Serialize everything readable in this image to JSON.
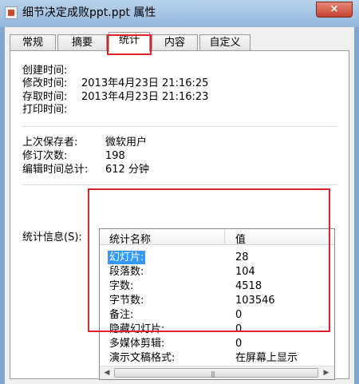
{
  "window": {
    "title": "细节决定成败ppt.ppt 属性",
    "close_icon": "×"
  },
  "tabs": [
    {
      "label": "常规"
    },
    {
      "label": "摘要"
    },
    {
      "label": "统计"
    },
    {
      "label": "内容"
    },
    {
      "label": "自定义"
    }
  ],
  "dates": {
    "created_label": "创建时间:",
    "created_value": "",
    "modified_label": "修改时间:",
    "modified_value": "2013年4月23日 21:16:25",
    "accessed_label": "存取时间:",
    "accessed_value": "2013年4月23日 21:16:23",
    "printed_label": "打印时间:",
    "printed_value": ""
  },
  "info": {
    "saved_by_label": "上次保存者:",
    "saved_by_value": "微软用户",
    "revision_label": "修订次数:",
    "revision_value": "198",
    "edit_time_label": "编辑时间总计:",
    "edit_time_value": "612 分钟"
  },
  "stats": {
    "label": "统计信息(S):",
    "col_name": "统计名称",
    "col_value": "值",
    "rows": [
      {
        "name": "幻灯片:",
        "value": "28"
      },
      {
        "name": "段落数:",
        "value": "104"
      },
      {
        "name": "字数:",
        "value": "4518"
      },
      {
        "name": "字节数:",
        "value": "103546"
      },
      {
        "name": "备注:",
        "value": "0"
      },
      {
        "name": "隐藏幻灯片:",
        "value": "0"
      },
      {
        "name": "多媒体剪辑:",
        "value": "0"
      },
      {
        "name": "演示文稿格式:",
        "value": "在屏幕上显示"
      }
    ]
  }
}
